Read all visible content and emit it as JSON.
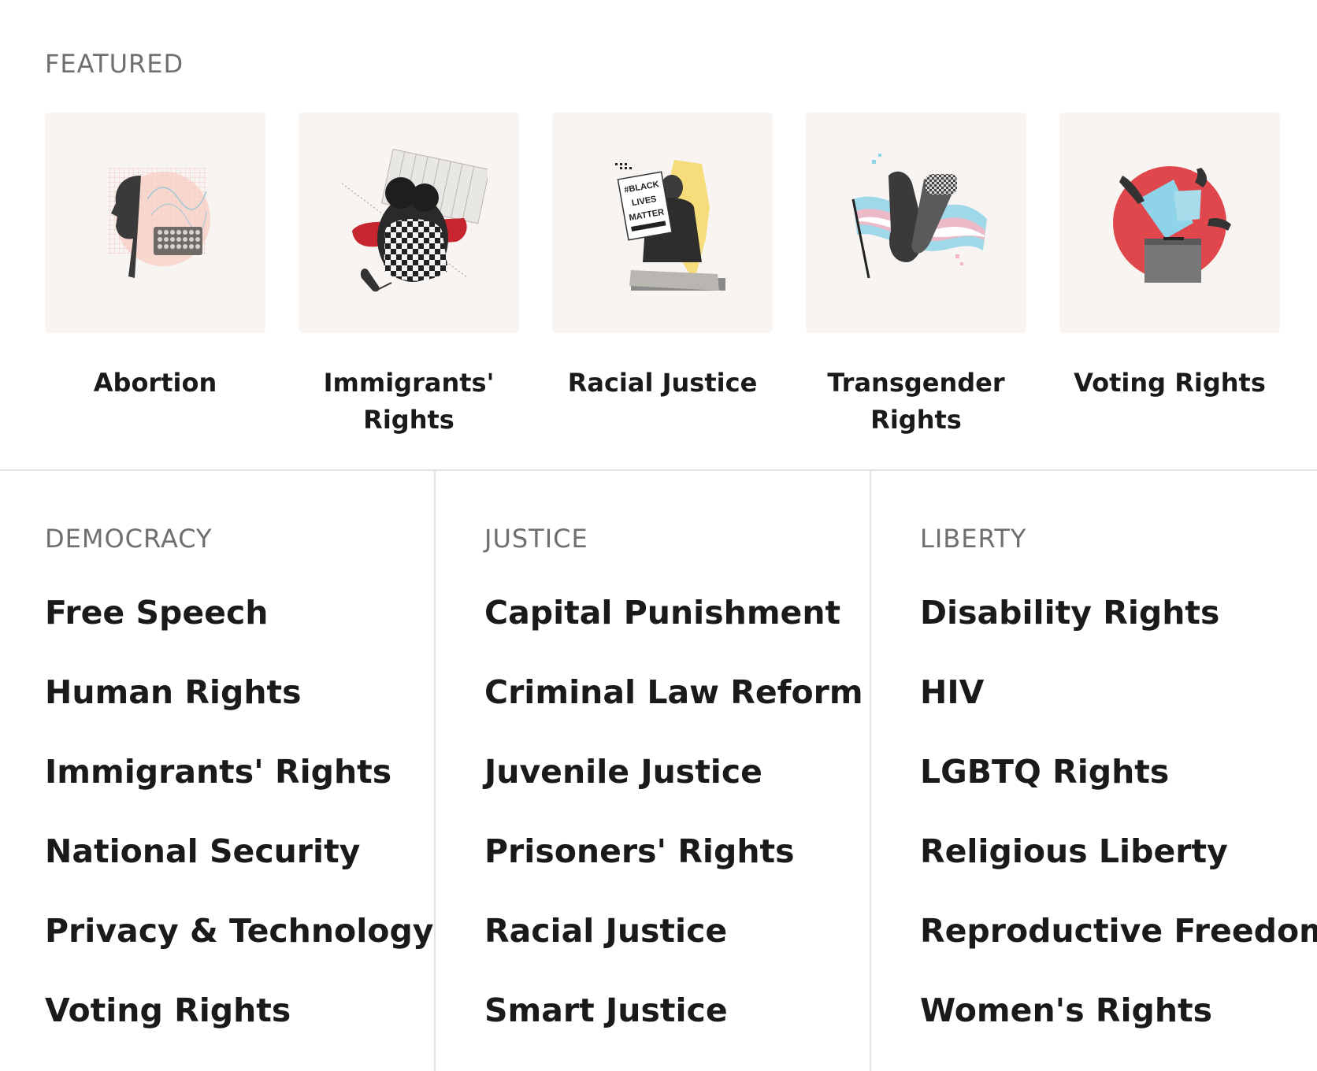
{
  "featured": {
    "heading": "FEATURED",
    "cards": [
      {
        "title": "Abortion",
        "icon": "abortion-illustration"
      },
      {
        "title": "Immigrants' Rights",
        "icon": "immigrants-rights-illustration"
      },
      {
        "title": "Racial Justice",
        "icon": "racial-justice-illustration",
        "sign_text": "#BLACK LIVES MATTER"
      },
      {
        "title": "Transgender Rights",
        "icon": "transgender-rights-illustration"
      },
      {
        "title": "Voting Rights",
        "icon": "voting-rights-illustration"
      }
    ]
  },
  "columns": [
    {
      "heading": "DEMOCRACY",
      "items": [
        "Free Speech",
        "Human Rights",
        "Immigrants' Rights",
        "National Security",
        "Privacy & Technology",
        "Voting Rights"
      ]
    },
    {
      "heading": "JUSTICE",
      "items": [
        "Capital Punishment",
        "Criminal Law Reform",
        "Juvenile Justice",
        "Prisoners' Rights",
        "Racial Justice",
        "Smart Justice"
      ]
    },
    {
      "heading": "LIBERTY",
      "items": [
        "Disability Rights",
        "HIV",
        "LGBTQ Rights",
        "Religious Liberty",
        "Reproductive Freedom",
        "Women's Rights"
      ]
    }
  ],
  "colors": {
    "card_background": "#f7f4f1",
    "heading_gray": "#6f6f6f",
    "text": "#1a1a1a",
    "divider": "#e2e2e2",
    "accent_red": "#e0474c",
    "accent_yellow": "#f6dc7a",
    "trans_blue": "#8fd3e8",
    "trans_pink": "#f4b6c2"
  }
}
